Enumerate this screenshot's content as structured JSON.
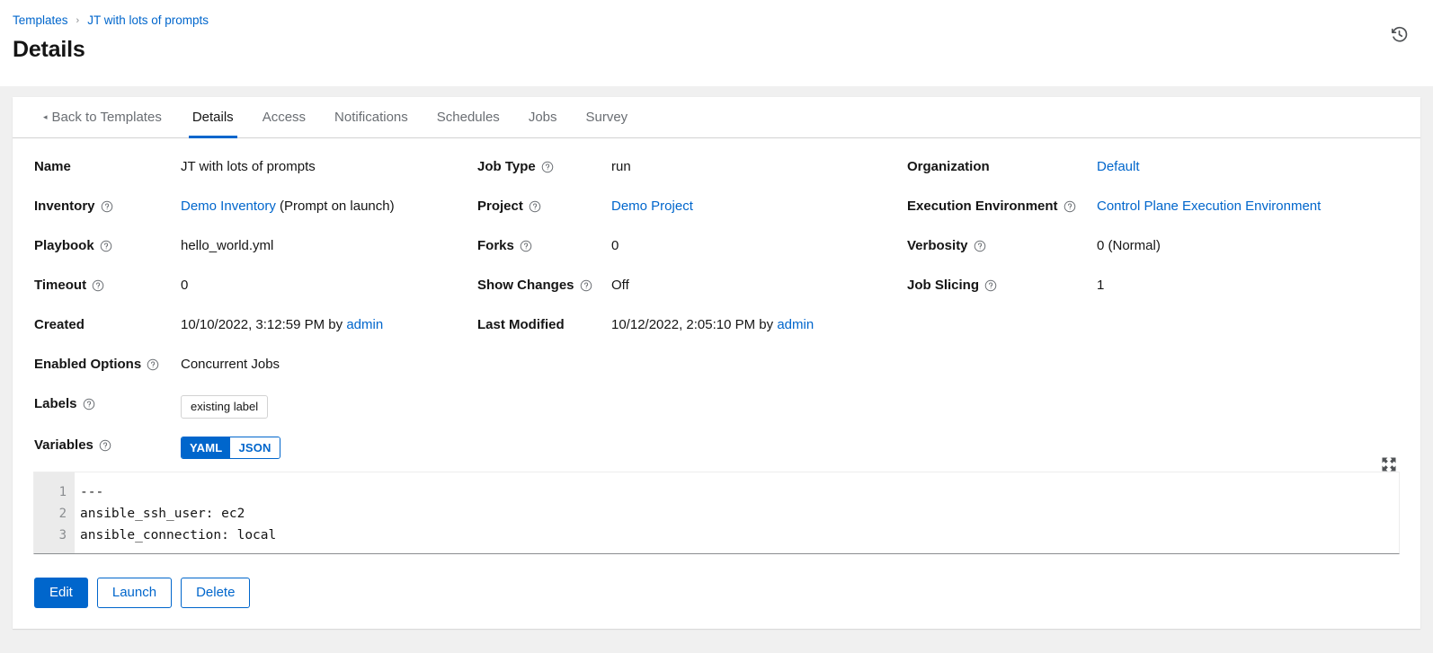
{
  "header": {
    "breadcrumb": [
      {
        "label": "Templates",
        "link": true
      },
      {
        "label": "JT with lots of prompts",
        "link": true
      }
    ],
    "separator": "›",
    "title": "Details",
    "history_icon": "history-clock-icon"
  },
  "tabs": [
    {
      "label": "Back to Templates",
      "active": false,
      "back": true
    },
    {
      "label": "Details",
      "active": true
    },
    {
      "label": "Access",
      "active": false
    },
    {
      "label": "Notifications",
      "active": false
    },
    {
      "label": "Schedules",
      "active": false
    },
    {
      "label": "Jobs",
      "active": false
    },
    {
      "label": "Survey",
      "active": false
    }
  ],
  "details": {
    "name": {
      "label": "Name",
      "value": "JT with lots of prompts",
      "help": false
    },
    "job_type": {
      "label": "Job Type",
      "value": "run",
      "help": true
    },
    "organization": {
      "label": "Organization",
      "value": "Default",
      "help": false,
      "link": true
    },
    "inventory": {
      "label": "Inventory",
      "value": "Demo Inventory",
      "suffix": " (Prompt on launch)",
      "help": true,
      "link": true
    },
    "project": {
      "label": "Project",
      "value": "Demo Project",
      "help": true,
      "link": true
    },
    "execution_environment": {
      "label": "Execution Environment",
      "value": "Control Plane Execution Environment",
      "help": true,
      "link": true
    },
    "playbook": {
      "label": "Playbook",
      "value": "hello_world.yml",
      "help": true
    },
    "forks": {
      "label": "Forks",
      "value": "0",
      "help": true
    },
    "verbosity": {
      "label": "Verbosity",
      "value": "0 (Normal)",
      "help": true
    },
    "timeout": {
      "label": "Timeout",
      "value": "0",
      "help": true
    },
    "show_changes": {
      "label": "Show Changes",
      "value": "Off",
      "help": true
    },
    "job_slicing": {
      "label": "Job Slicing",
      "value": "1",
      "help": true
    },
    "created": {
      "label": "Created",
      "value": "10/10/2022, 3:12:59 PM by ",
      "user": "admin",
      "help": false
    },
    "last_modified": {
      "label": "Last Modified",
      "value": "10/12/2022, 2:05:10 PM by ",
      "user": "admin",
      "help": false
    },
    "enabled_options": {
      "label": "Enabled Options",
      "value": "Concurrent Jobs",
      "help": true
    },
    "labels": {
      "label": "Labels",
      "help": true,
      "chips": [
        "existing label"
      ]
    },
    "variables": {
      "label": "Variables",
      "help": true,
      "format_yaml": "YAML",
      "format_json": "JSON",
      "selected_format": "YAML",
      "expand_icon": "expand-arrows-icon",
      "lines": [
        "---",
        "ansible_ssh_user: ec2",
        "ansible_connection: local"
      ],
      "line_numbers": [
        "1",
        "2",
        "3"
      ]
    }
  },
  "actions": {
    "edit": "Edit",
    "launch": "Launch",
    "delete": "Delete"
  },
  "colors": {
    "accent": "#0066CC",
    "page_bg": "#F0F0F0",
    "card_bg": "#FFFFFF",
    "text": "#151515",
    "muted": "#6A6E73",
    "gutter": "#EBEBEB"
  }
}
